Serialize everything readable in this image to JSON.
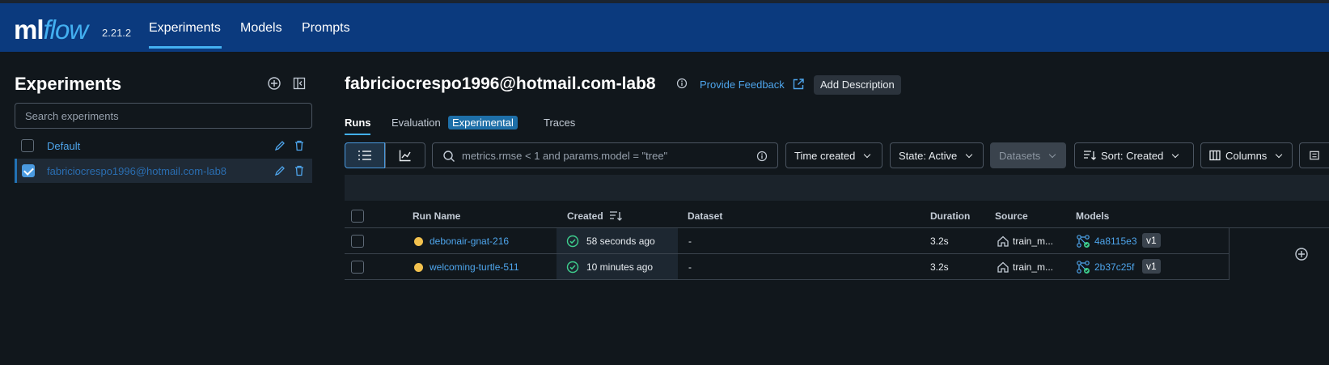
{
  "header": {
    "logo_ml": "ml",
    "logo_flow": "flow",
    "version": "2.21.2",
    "nav": [
      {
        "label": "Experiments"
      },
      {
        "label": "Models"
      },
      {
        "label": "Prompts"
      }
    ]
  },
  "sidebar": {
    "title": "Experiments",
    "search_placeholder": "Search experiments",
    "experiments": [
      {
        "name": "Default",
        "checked": false
      },
      {
        "name": "fabriciocrespo1996@hotmail.com-lab8",
        "checked": true
      }
    ]
  },
  "main": {
    "title": "fabriciocrespo1996@hotmail.com-lab8",
    "feedback_label": "Provide Feedback",
    "add_description_label": "Add Description",
    "tabs": [
      {
        "label": "Runs"
      },
      {
        "label": "Evaluation"
      },
      {
        "label": "Traces"
      }
    ],
    "evaluation_badge": "Experimental",
    "filter_placeholder": "metrics.rmse < 1 and params.model = \"tree\"",
    "toolbar": {
      "time_created": "Time created",
      "state": "State: Active",
      "datasets": "Datasets",
      "sort": "Sort: Created",
      "columns": "Columns"
    },
    "table": {
      "headers": {
        "run_name": "Run Name",
        "created": "Created",
        "dataset": "Dataset",
        "duration": "Duration",
        "source": "Source",
        "models": "Models"
      },
      "rows": [
        {
          "run_name": "debonair-gnat-216",
          "created": "58 seconds ago",
          "dataset": "-",
          "duration": "3.2s",
          "source": "train_m...",
          "model": "4a8115e3",
          "version": "v1"
        },
        {
          "run_name": "welcoming-turtle-511",
          "created": "10 minutes ago",
          "dataset": "-",
          "duration": "3.2s",
          "source": "train_m...",
          "model": "2b37c25f",
          "version": "v1"
        }
      ]
    }
  },
  "colors": {
    "header_bg": "#0b3a7e",
    "accent": "#43b0f1",
    "link": "#4ea5ec",
    "status_running": "#f2c14e",
    "success": "#3ecf8e"
  }
}
